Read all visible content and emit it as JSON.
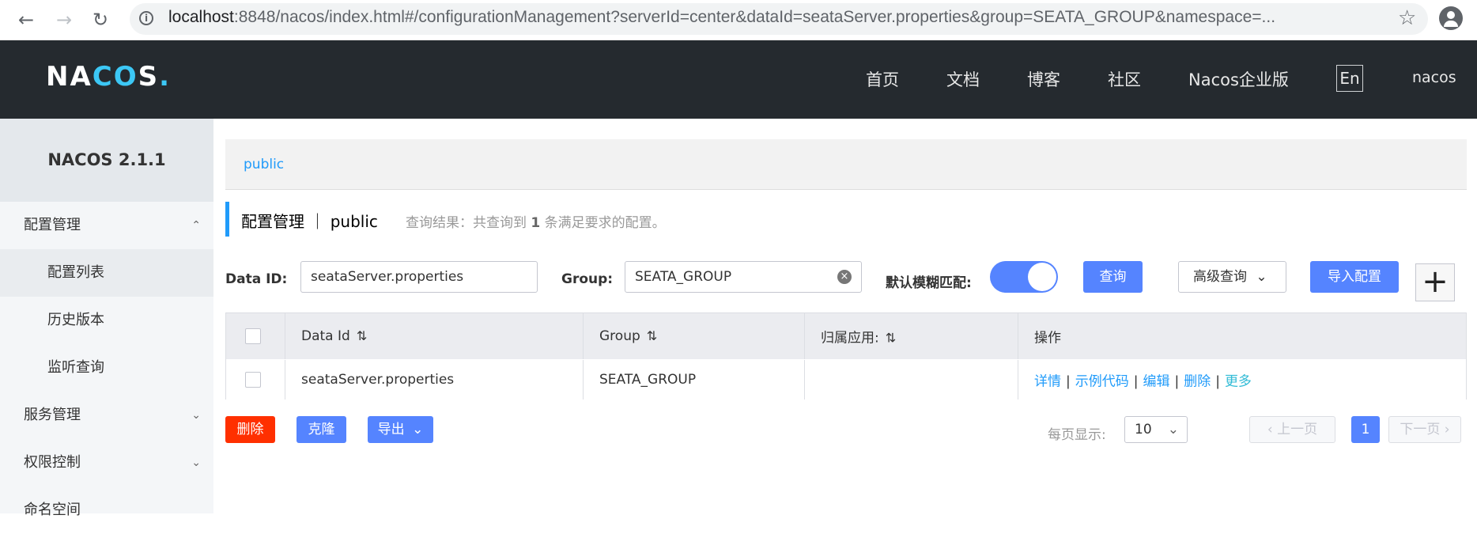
{
  "browser": {
    "url_host": "localhost",
    "url_rest": ":8848/nacos/index.html#/configurationManagement?serverId=center&dataId=seataServer.properties&group=SEATA_GROUP&namespace=..."
  },
  "header": {
    "logo_a": "NA",
    "logo_b": "CO",
    "logo_c": "S",
    "logo_dot": ".",
    "nav": [
      "首页",
      "文档",
      "博客",
      "社区",
      "Nacos企业版"
    ],
    "lang": "En",
    "user": "nacos"
  },
  "sidebar": {
    "version": "NACOS 2.1.1",
    "items": [
      {
        "label": "配置管理",
        "type": "group"
      },
      {
        "label": "配置列表",
        "type": "sub"
      },
      {
        "label": "历史版本",
        "type": "sub"
      },
      {
        "label": "监听查询",
        "type": "sub"
      },
      {
        "label": "服务管理",
        "type": "group"
      },
      {
        "label": "权限控制",
        "type": "group"
      },
      {
        "label": "命名空间",
        "type": "group"
      }
    ]
  },
  "main": {
    "namespace_link": "public",
    "title": "配置管理 ｜ public",
    "result_prefix": "查询结果：共查询到 ",
    "result_count": "1",
    "result_suffix": " 条满足要求的配置。",
    "data_id_label": "Data ID:",
    "data_id_value": "seataServer.properties",
    "group_label": "Group:",
    "group_value": "SEATA_GROUP",
    "fuzzy_label": "默认模糊匹配:",
    "query_button": "查询",
    "advanced_button": "高级查询",
    "import_button": "导入配置",
    "plus": "+"
  },
  "table": {
    "headers": [
      "Data Id",
      "Group",
      "归属应用:",
      "操作"
    ],
    "rows": [
      {
        "data_id": "seataServer.properties",
        "group": "SEATA_GROUP",
        "app": ""
      }
    ],
    "ops": [
      "详情",
      "示例代码",
      "编辑",
      "删除",
      "更多"
    ]
  },
  "footer": {
    "delete": "删除",
    "clone": "克隆",
    "export": "导出",
    "per_page_label": "每页显示:",
    "per_page_value": "10",
    "prev": "上一页",
    "current_page": "1",
    "next": "下一页"
  },
  "colors": {
    "topbar": "#252a2f",
    "primary": "#5584ff",
    "link": "#209bfa",
    "danger": "#ff3000"
  }
}
